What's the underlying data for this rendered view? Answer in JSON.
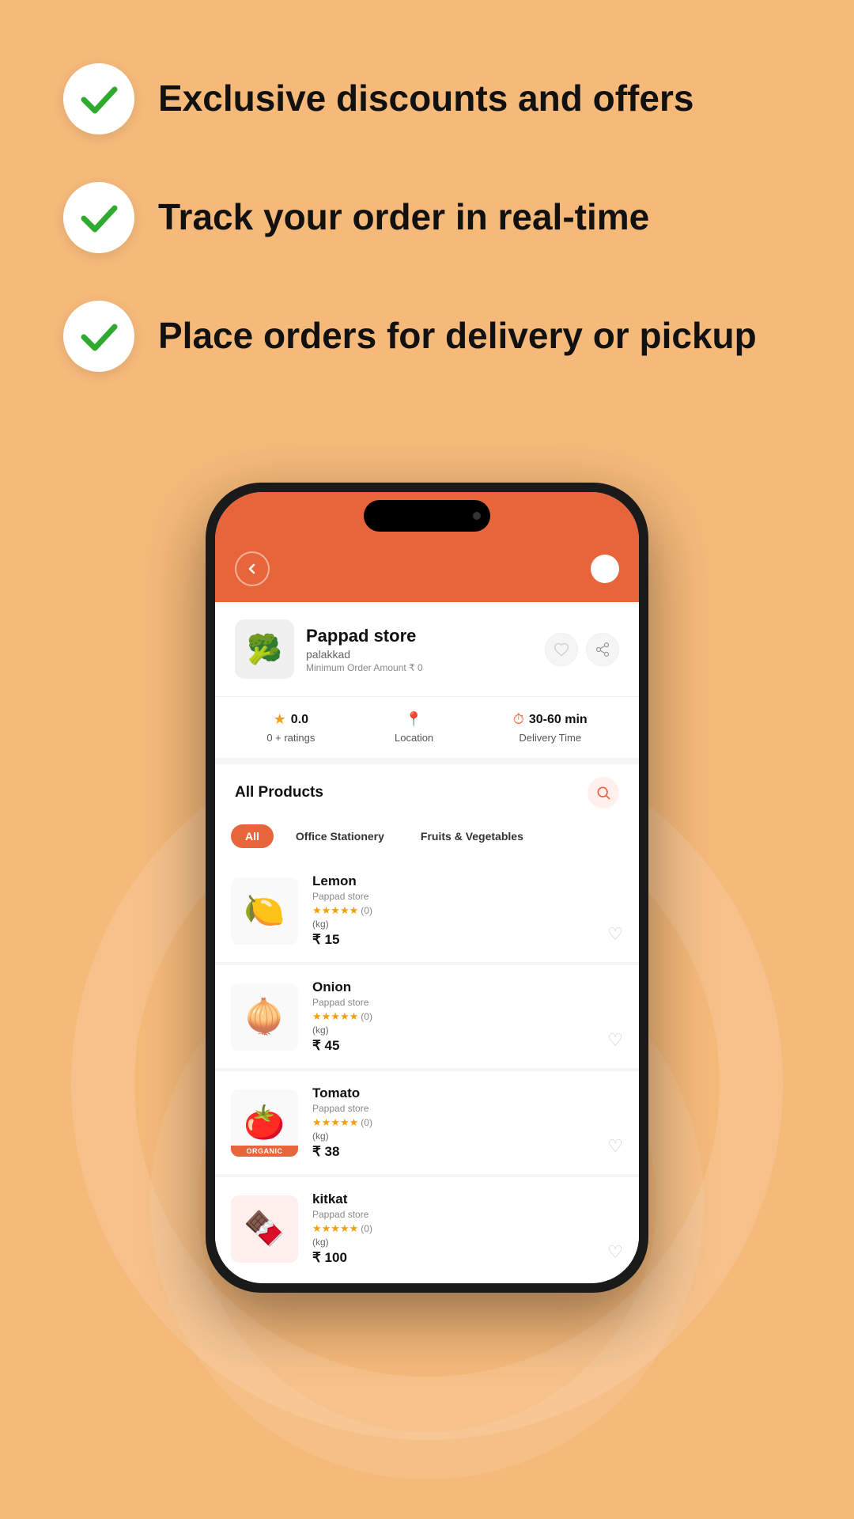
{
  "background_color": "#F5B97A",
  "features": [
    {
      "id": "feat1",
      "text": "Exclusive discounts and offers"
    },
    {
      "id": "feat2",
      "text": "Track your order in real-time"
    },
    {
      "id": "feat3",
      "text": "Place orders for delivery or pickup"
    }
  ],
  "store": {
    "name": "Pappad store",
    "location": "palakkad",
    "min_order": "Minimum Order Amount  ₹ 0",
    "rating": "0.0",
    "ratings_count": "0 + ratings",
    "location_label": "Location",
    "delivery_time": "30-60 min",
    "delivery_label": "Delivery Time"
  },
  "products_section": {
    "title": "All Products",
    "categories": [
      {
        "id": "all",
        "label": "All",
        "active": true
      },
      {
        "id": "stationery",
        "label": "Office Stationery",
        "active": false
      },
      {
        "id": "fruits",
        "label": "Fruits & Vegetables",
        "active": false
      }
    ],
    "items": [
      {
        "id": "lemon",
        "name": "Lemon",
        "store": "Pappad store",
        "rating": "★★★★★",
        "rating_count": "(0)",
        "unit": "(kg)",
        "price": "₹ 15",
        "emoji": "🍋",
        "organic": false
      },
      {
        "id": "onion",
        "name": "Onion",
        "store": "Pappad store",
        "rating": "★★★★★",
        "rating_count": "(0)",
        "unit": "(kg)",
        "price": "₹ 45",
        "emoji": "🧅",
        "organic": false
      },
      {
        "id": "tomato",
        "name": "Tomato",
        "store": "Pappad store",
        "rating": "★★★★★",
        "rating_count": "(0)",
        "unit": "(kg)",
        "price": "₹ 38",
        "emoji": "🍅",
        "organic": true,
        "organic_label": "ORGANIC"
      },
      {
        "id": "kitkat",
        "name": "kitkat",
        "store": "Pappad store",
        "rating": "★★★★★",
        "rating_count": "(0)",
        "unit": "(kg)",
        "price": "₹ 100",
        "emoji": "🍫",
        "organic": false
      }
    ]
  },
  "buttons": {
    "back": "‹",
    "heart": "♡",
    "share": "↗",
    "search": "🔍"
  }
}
